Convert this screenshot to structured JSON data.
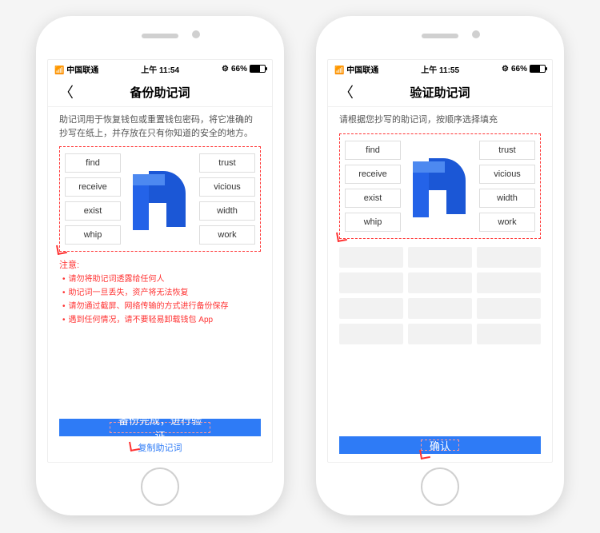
{
  "status": {
    "carrier": "中国联通",
    "time1": "上午 11:54",
    "time2": "上午 11:55",
    "battery": "66%"
  },
  "left": {
    "title": "备份助记词",
    "desc": "助记词用于恢复钱包或重置钱包密码，将它准确的抄写在纸上，并存放在只有你知道的安全的地方。",
    "words_l": [
      "find",
      "receive",
      "exist",
      "whip"
    ],
    "words_r": [
      "trust",
      "vicious",
      "width",
      "work"
    ],
    "warn_title": "注意:",
    "warns": [
      "请勿将助记词透露给任何人",
      "助记词一旦丢失，资产将无法恢复",
      "请勿通过截屏、网络传输的方式进行备份保存",
      "遇到任何情况，请不要轻易卸载钱包 App"
    ],
    "btn": "备份完成，进行验证",
    "link": "复制助记词"
  },
  "right": {
    "title": "验证助记词",
    "desc": "请根据您抄写的助记词，按顺序选择填充",
    "words_l": [
      "find",
      "receive",
      "exist",
      "whip"
    ],
    "words_r": [
      "trust",
      "vicious",
      "width",
      "work"
    ],
    "btn": "确认"
  }
}
